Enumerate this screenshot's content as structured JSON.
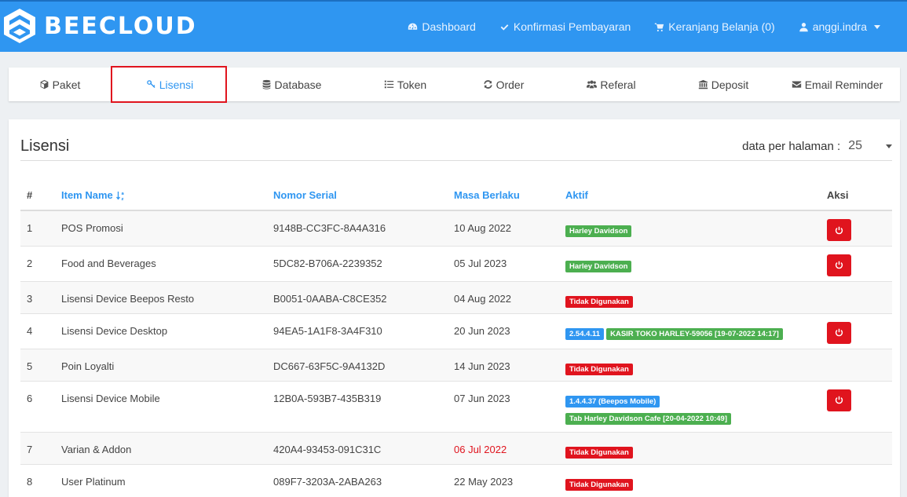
{
  "app": {
    "brand": "BEECLOUD",
    "colors": {
      "primary": "#2f96f1",
      "danger": "#e0141e",
      "success": "#4caf50"
    }
  },
  "nav": {
    "dashboard": "Dashboard",
    "konfirmasi": "Konfirmasi Pembayaran",
    "keranjang": "Keranjang Belanja (0)",
    "user": "anggi.indra"
  },
  "tabs": [
    {
      "label": "Paket",
      "icon": "cube-icon"
    },
    {
      "label": "Lisensi",
      "icon": "key-icon",
      "active": true
    },
    {
      "label": "Database",
      "icon": "database-icon"
    },
    {
      "label": "Token",
      "icon": "list-icon"
    },
    {
      "label": "Order",
      "icon": "refresh-icon"
    },
    {
      "label": "Referal",
      "icon": "users-icon"
    },
    {
      "label": "Deposit",
      "icon": "bank-icon"
    },
    {
      "label": "Email Reminder",
      "icon": "envelope-icon"
    }
  ],
  "panel": {
    "title": "Lisensi",
    "per_page_label": "data per halaman :",
    "per_page_value": "25"
  },
  "table": {
    "headers": {
      "no": "#",
      "name": "Item Name",
      "serial": "Nomor Serial",
      "date": "Masa Berlaku",
      "aktif": "Aktif",
      "aksi": "Aksi"
    },
    "rows": [
      {
        "no": "1",
        "name": "POS Promosi",
        "serial": "9148B-CC3FC-8A4A316",
        "date": "10 Aug 2022",
        "b1": "Harley Davidson"
      },
      {
        "no": "2",
        "name": "Food and Beverages",
        "serial": "5DC82-B706A-2239352",
        "date": "05 Jul 2023",
        "b1": "Harley Davidson"
      },
      {
        "no": "3",
        "name": "Lisensi Device Beepos Resto",
        "serial": "B0051-0AABA-C8CE352",
        "date": "04 Aug 2022",
        "b1": "Tidak Digunakan"
      },
      {
        "no": "4",
        "name": "Lisensi Device Desktop",
        "serial": "94EA5-1A1F8-3A4F310",
        "date": "20 Jun 2023",
        "b1": "2.54.4.11",
        "b2": "KASIR TOKO HARLEY-59056 [19-07-2022 14:17]"
      },
      {
        "no": "5",
        "name": "Poin Loyalti",
        "serial": "DC667-63F5C-9A4132D",
        "date": "14 Jun 2023",
        "b1": "Tidak Digunakan"
      },
      {
        "no": "6",
        "name": "Lisensi Device Mobile",
        "serial": "12B0A-593B7-435B319",
        "date": "07 Jun 2023",
        "b1": "1.4.4.37 (Beepos Mobile)",
        "b2": "Tab Harley Davidson Cafe [20-04-2022 10:49]"
      },
      {
        "no": "7",
        "name": "Varian & Addon",
        "serial": "420A4-93453-091C31C",
        "date": "06 Jul 2022",
        "b1": "Tidak Digunakan"
      },
      {
        "no": "8",
        "name": "User Platinum",
        "serial": "089F7-3203A-2ABA263",
        "date": "22 May 2023",
        "b1": "Tidak Digunakan"
      }
    ]
  }
}
